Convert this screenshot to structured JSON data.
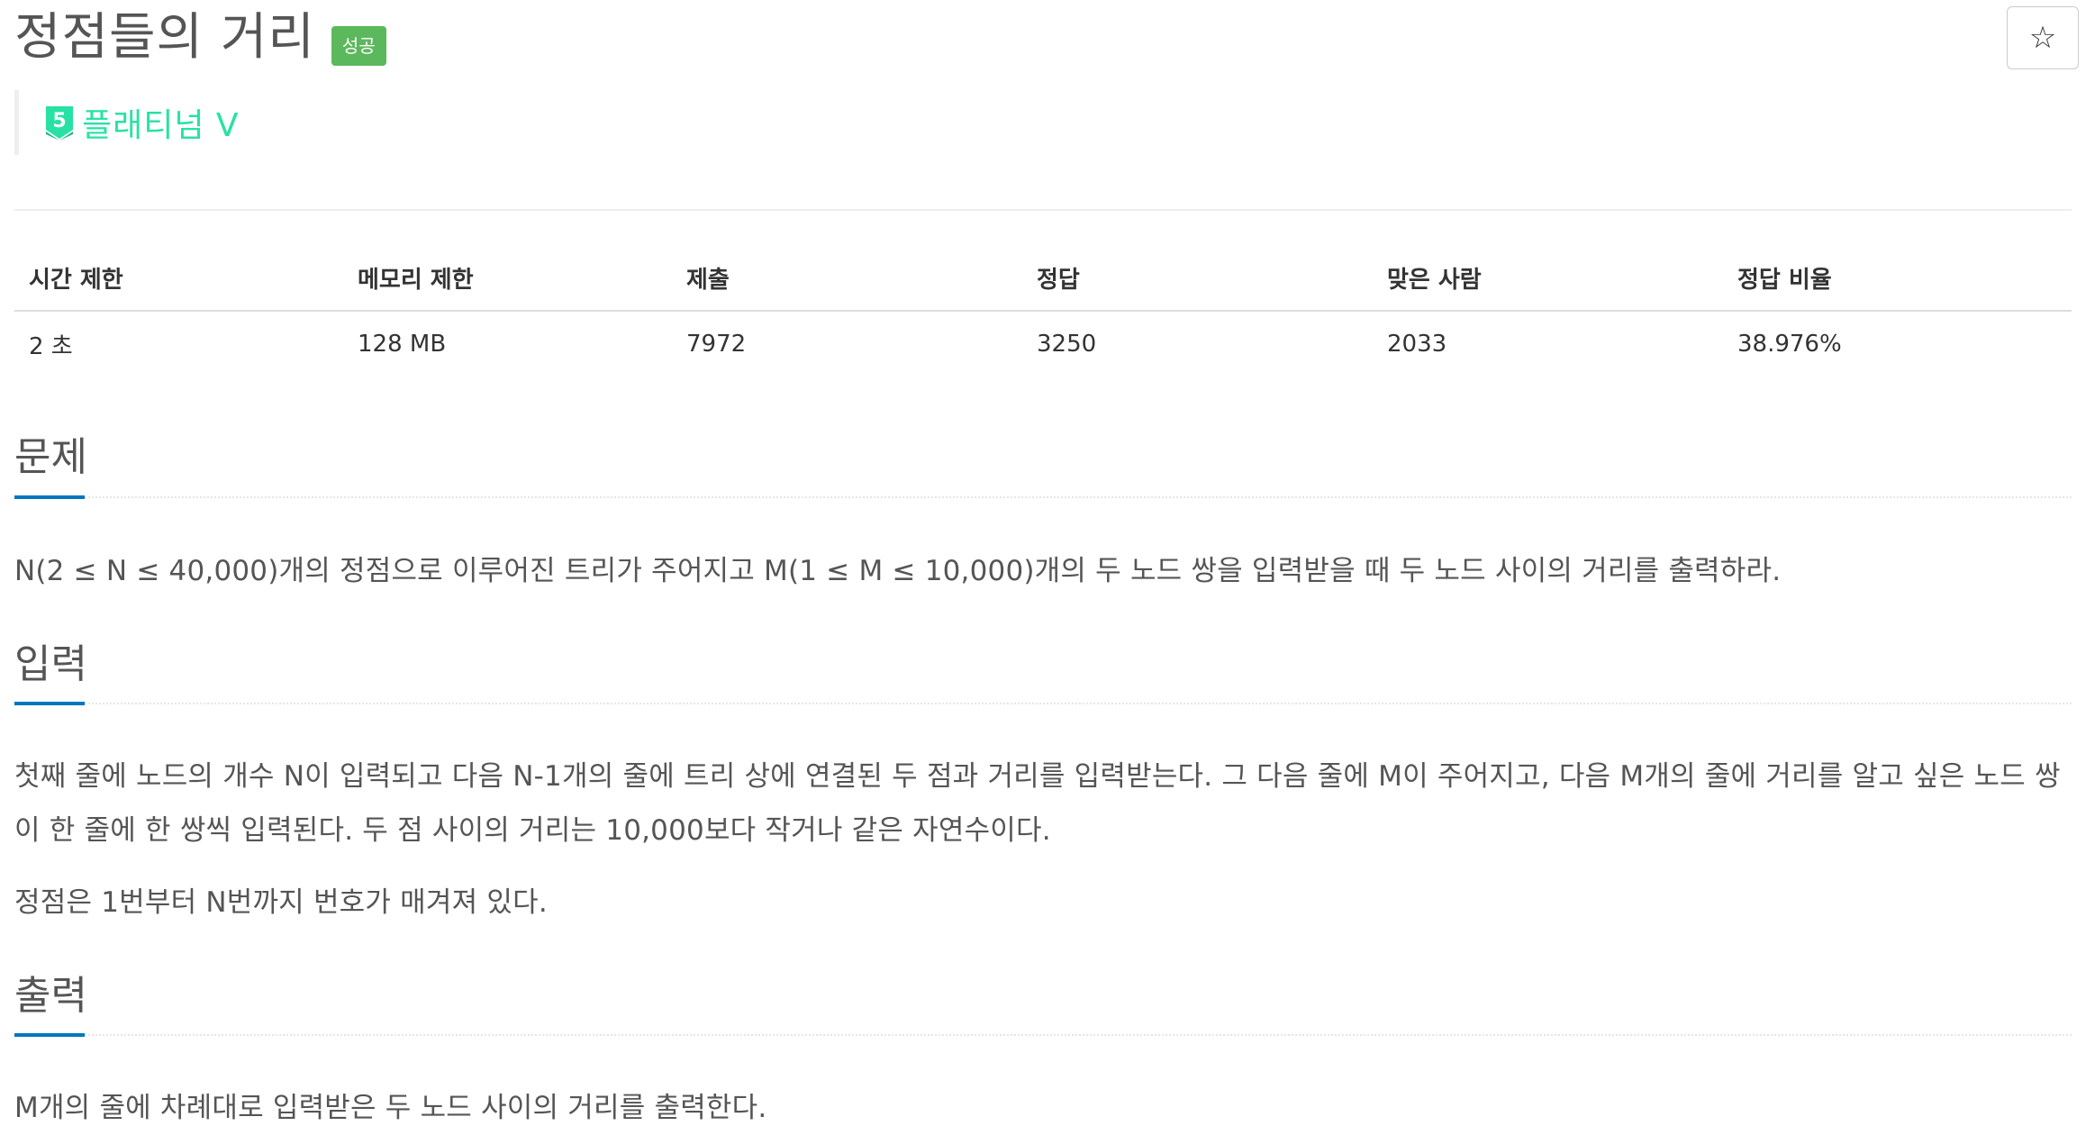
{
  "header": {
    "title": "정점들의 거리",
    "status_badge": "성공",
    "star_icon": "star-outline-icon"
  },
  "tier": {
    "level": "5",
    "label": "플래티넘 V",
    "color": "#27e2a4"
  },
  "info_table": {
    "headers": [
      "시간 제한",
      "메모리 제한",
      "제출",
      "정답",
      "맞은 사람",
      "정답 비율"
    ],
    "values": [
      "2 초",
      "128 MB",
      "7972",
      "3250",
      "2033",
      "38.976%"
    ]
  },
  "sections": {
    "problem": {
      "title": "문제",
      "paragraphs": [
        "N(2 ≤ N ≤ 40,000)개의 정점으로 이루어진 트리가 주어지고 M(1 ≤ M ≤ 10,000)개의 두 노드 쌍을 입력받을 때 두 노드 사이의 거리를 출력하라."
      ]
    },
    "input": {
      "title": "입력",
      "paragraphs": [
        "첫째 줄에 노드의 개수 N이 입력되고 다음 N-1개의 줄에 트리 상에 연결된 두 점과 거리를 입력받는다. 그 다음 줄에 M이 주어지고, 다음 M개의 줄에 거리를 알고 싶은 노드 쌍이 한 줄에 한 쌍씩 입력된다. 두 점 사이의 거리는 10,000보다 작거나 같은 자연수이다.",
        "정점은 1번부터 N번까지 번호가 매겨져 있다."
      ]
    },
    "output": {
      "title": "출력",
      "paragraphs": [
        "M개의 줄에 차례대로 입력받은 두 노드 사이의 거리를 출력한다."
      ]
    }
  },
  "colors": {
    "success": "#5cb85c",
    "accent": "#0076c0"
  }
}
